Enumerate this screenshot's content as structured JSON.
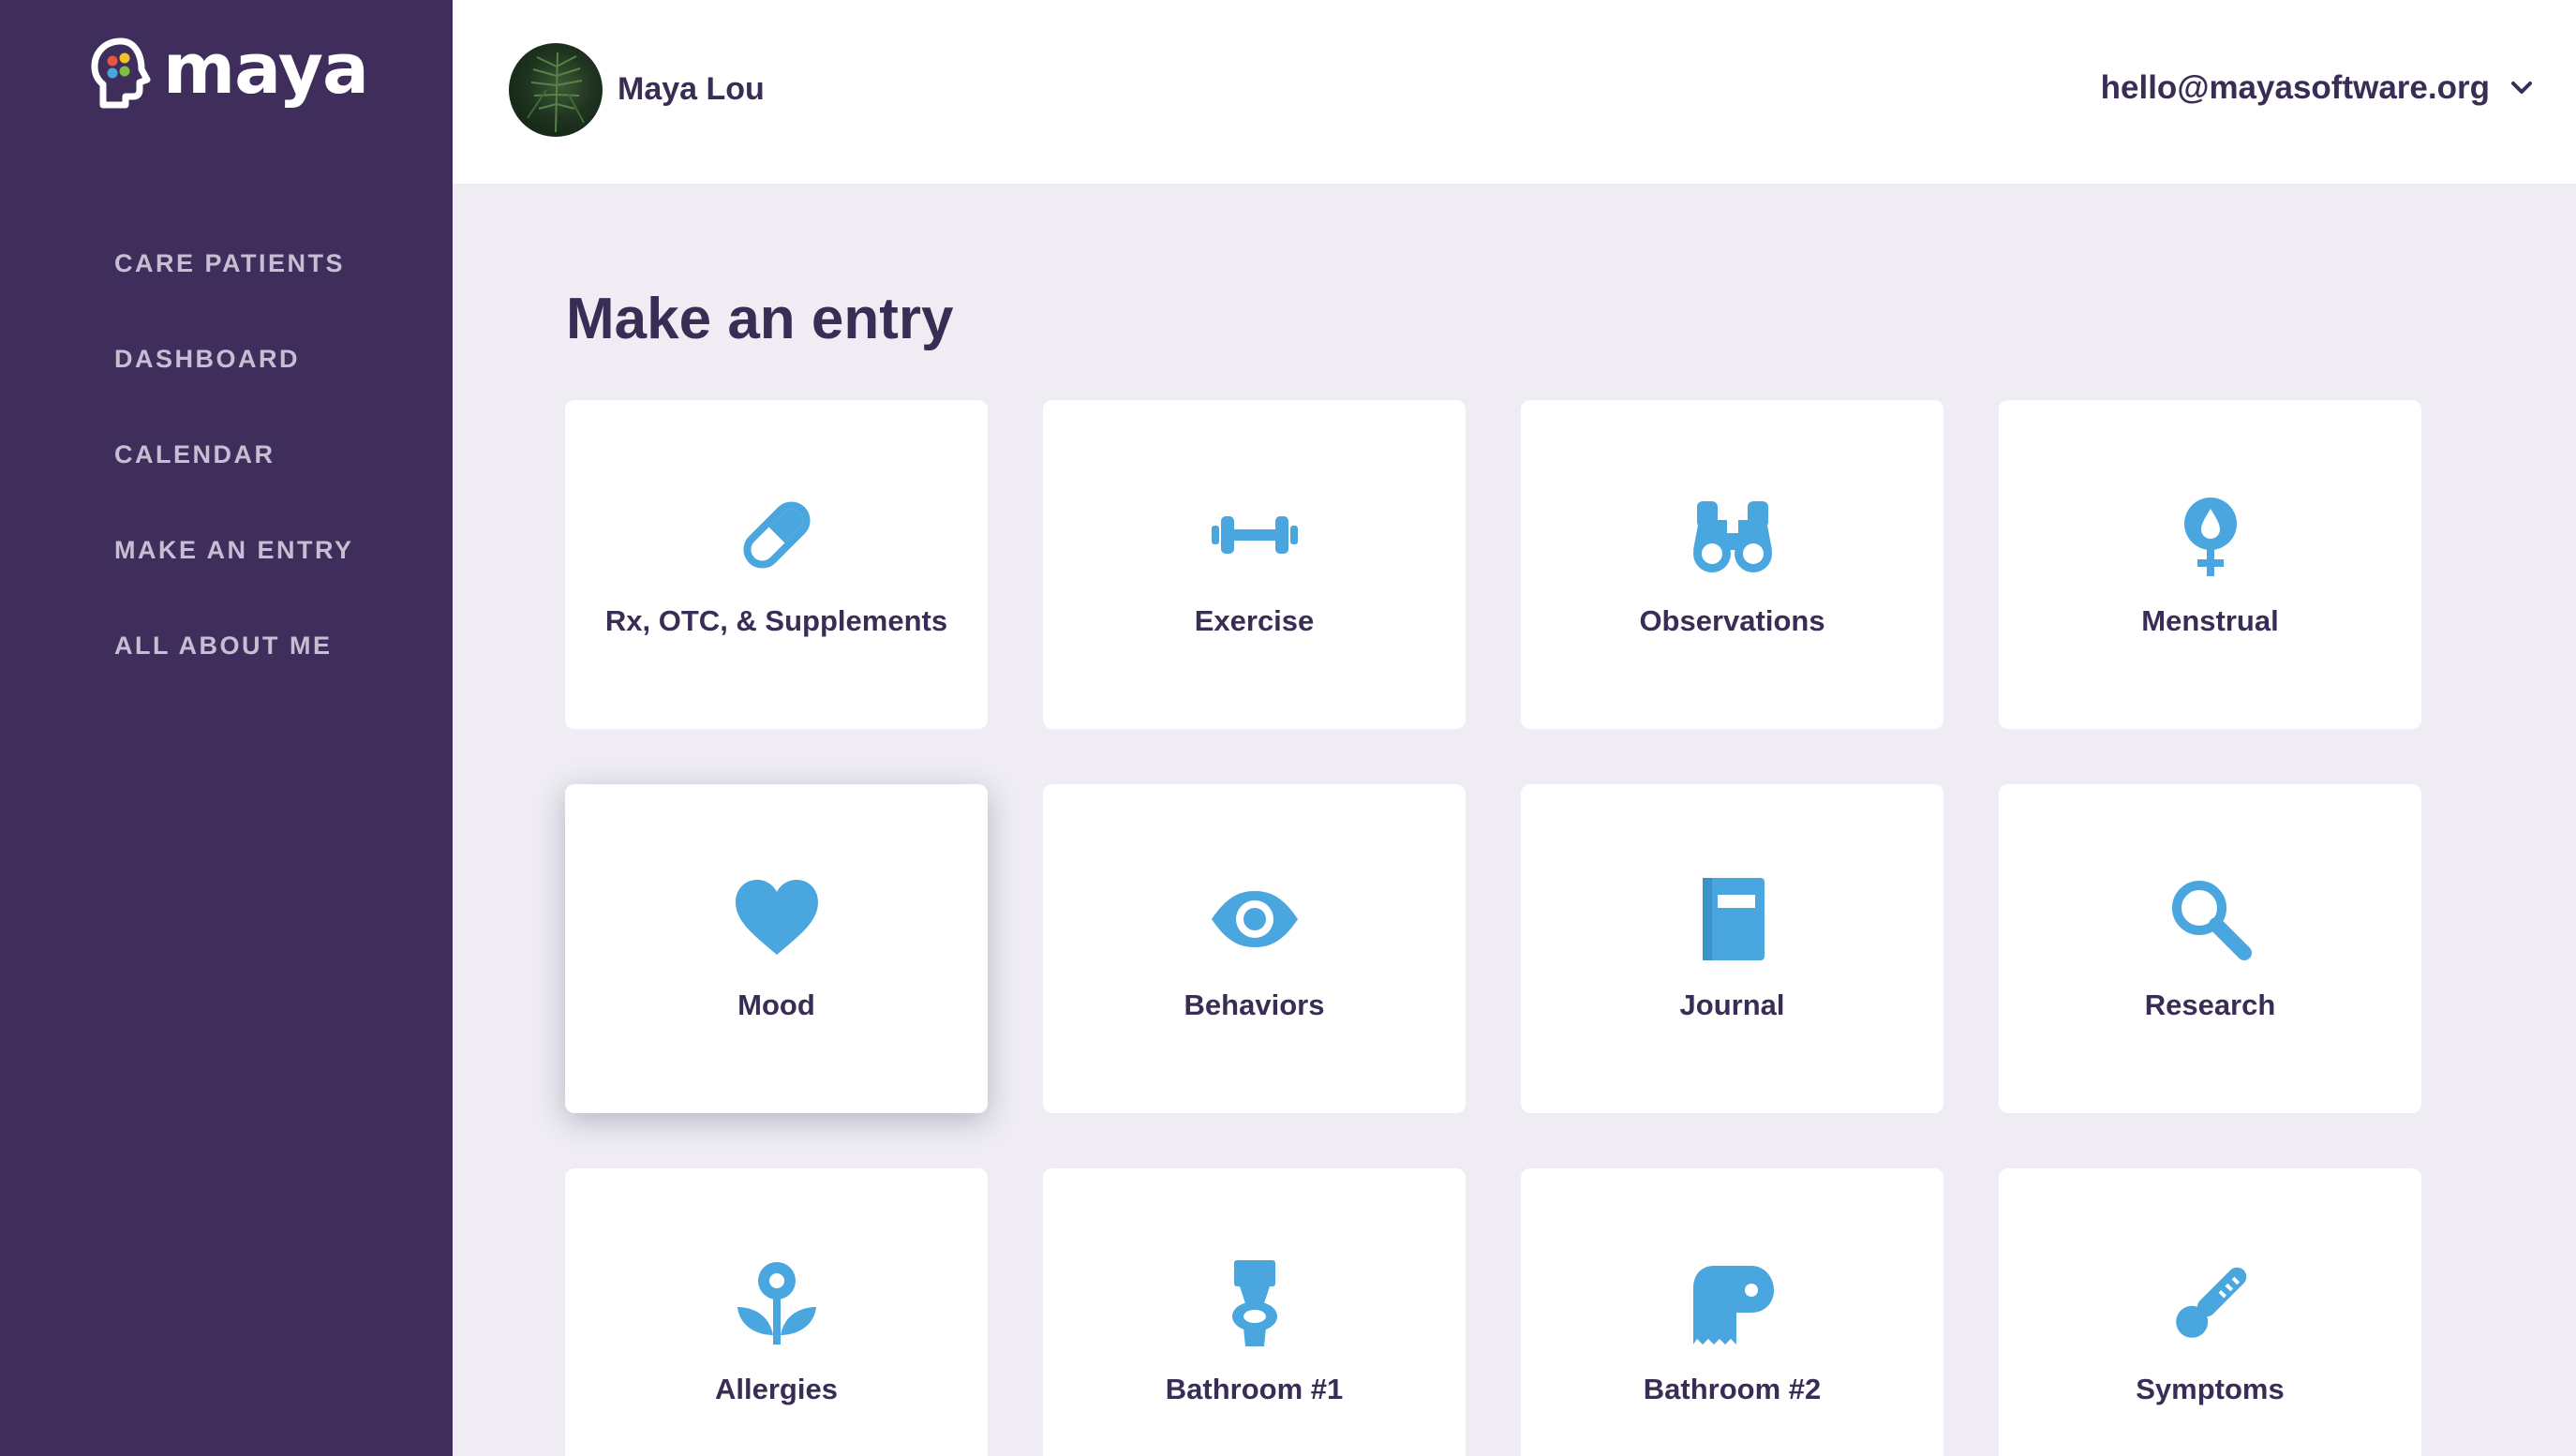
{
  "brand": {
    "name": "maya"
  },
  "sidebar": {
    "items": [
      {
        "label": "CARE PATIENTS"
      },
      {
        "label": "DASHBOARD"
      },
      {
        "label": "CALENDAR"
      },
      {
        "label": "MAKE AN ENTRY"
      },
      {
        "label": "ALL ABOUT ME"
      }
    ]
  },
  "header": {
    "user_name": "Maya Lou",
    "account_email": "hello@mayasoftware.org"
  },
  "main": {
    "title": "Make an entry",
    "cards": [
      {
        "label": "Rx, OTC, & Supplements",
        "icon": "pill-icon"
      },
      {
        "label": "Exercise",
        "icon": "dumbbell-icon"
      },
      {
        "label": "Observations",
        "icon": "binoculars-icon"
      },
      {
        "label": "Menstrual",
        "icon": "menstrual-icon"
      },
      {
        "label": "Mood",
        "icon": "heart-icon"
      },
      {
        "label": "Behaviors",
        "icon": "eye-icon"
      },
      {
        "label": "Journal",
        "icon": "journal-icon"
      },
      {
        "label": "Research",
        "icon": "magnifier-icon"
      },
      {
        "label": "Allergies",
        "icon": "flower-icon"
      },
      {
        "label": "Bathroom #1",
        "icon": "toilet-icon"
      },
      {
        "label": "Bathroom #2",
        "icon": "toilet-paper-icon"
      },
      {
        "label": "Symptoms",
        "icon": "thermometer-icon"
      }
    ]
  },
  "colors": {
    "sidebar_bg": "#3f2d5c",
    "accent_icon": "#4aa6df",
    "text_dark": "#3a2d55",
    "page_bg": "#efedf3"
  }
}
